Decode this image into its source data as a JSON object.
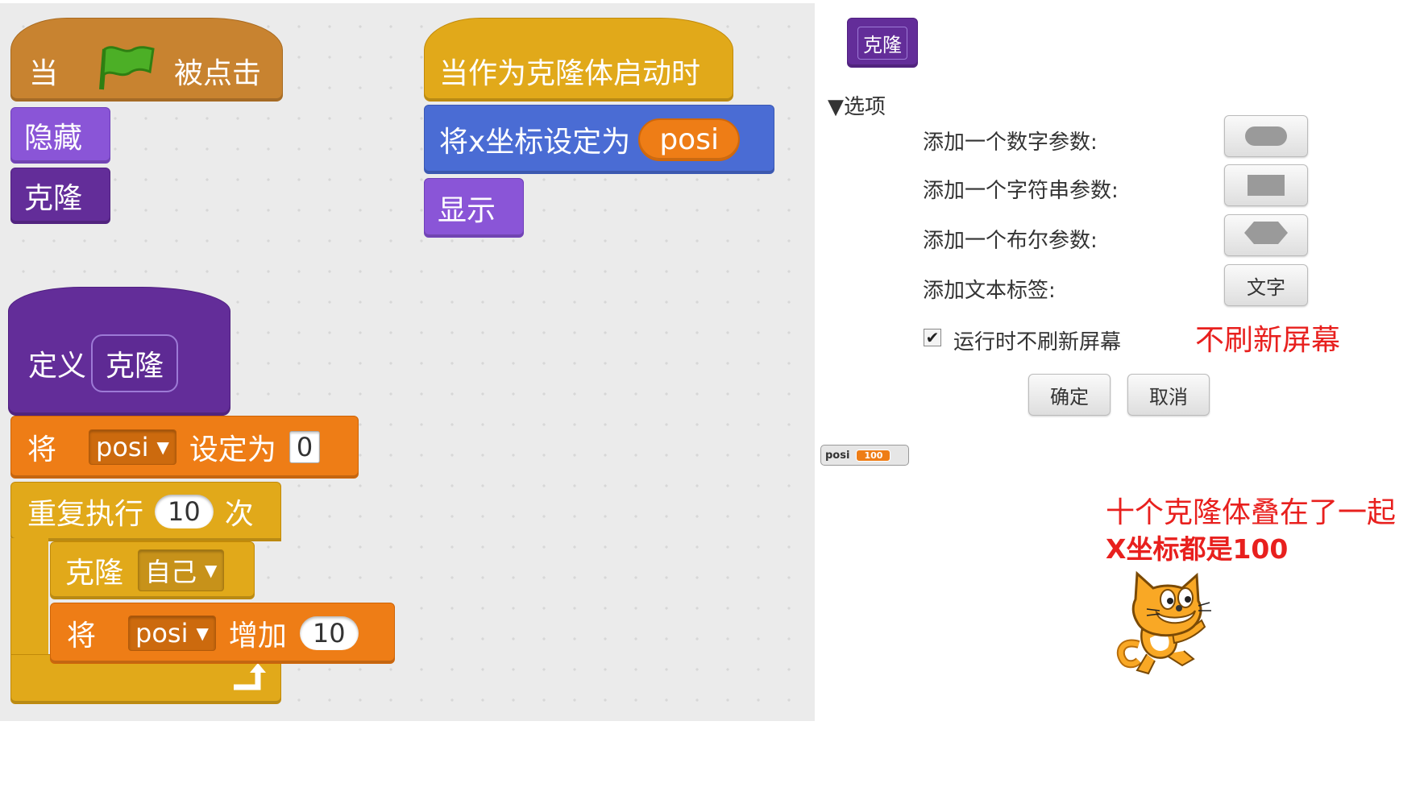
{
  "colors": {
    "events": "#c88330",
    "control": "#e1a91a",
    "motion": "#4a6cd4",
    "looks": "#8a55d7",
    "more_blocks": "#632d99",
    "data": "#ee7d16",
    "annotation_red": "#e8201e",
    "flag_green": "#4caf26"
  },
  "script1": {
    "hat_when": "当",
    "hat_clicked": "被点击",
    "flag_icon": "green-flag-icon",
    "hide": "隐藏",
    "clone_call": "克隆"
  },
  "script2": {
    "hat": "当作为克隆体启动时",
    "set_x": "将x坐标设定为",
    "set_x_var": "posi",
    "show": "显示"
  },
  "script3": {
    "define": "定义",
    "define_name": "克隆",
    "set_prefix": "将",
    "set_var": "posi",
    "set_to": "设定为",
    "set_value": "0",
    "repeat": "重复执行",
    "repeat_count": "10",
    "repeat_suffix": "次",
    "clone_label": "克隆",
    "clone_target": "自己",
    "change_prefix": "将",
    "change_var": "posi",
    "change_by": "增加",
    "change_value": "10",
    "loop_arrow_icon": "loop-arrow-icon"
  },
  "dialog": {
    "preview_block": "克隆",
    "options_toggle": "▼选项",
    "add_number": "添加一个数字参数:",
    "add_string": "添加一个字符串参数:",
    "add_boolean": "添加一个布尔参数:",
    "add_label": "添加文本标签:",
    "label_button": "文字",
    "run_without_refresh": "运行时不刷新屏幕",
    "run_without_refresh_checked": true,
    "ok": "确定",
    "cancel": "取消"
  },
  "annotations": {
    "no_refresh": "不刷新屏幕",
    "line1": "十个克隆体叠在了一起",
    "line2": "X坐标都是100"
  },
  "monitor": {
    "name": "posi",
    "value": "100"
  },
  "sprite": {
    "icon": "scratch-cat-icon"
  }
}
